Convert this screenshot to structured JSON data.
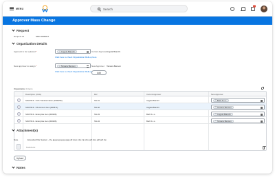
{
  "nav": {
    "menu_label": "MENU",
    "search_placeholder": "Search",
    "inbox_badge": "1"
  },
  "page": {
    "title": "Approver Mass Change"
  },
  "request": {
    "section_title": "Request",
    "request_id_label": "Request ID",
    "request_id_value": "MSC-0000017"
  },
  "org": {
    "section_title": "Organization Details",
    "approval_label": "Approval to be replaced",
    "approval_value": "Angela Bianchi",
    "new_approver_label": "New approver to assign",
    "new_approver_value": "Tamara Benson",
    "check_link": "Click here to check Organization Roll-up here",
    "check_link_2": "Click here to check Organization Roll-up here",
    "current_approver_label": "Current Approver",
    "current_approver_value": "Angela Bianchi",
    "new_approver_right_label": "New Approver",
    "new_approver_right_value": "Tamara Benson",
    "add_label": "Add"
  },
  "grid": {
    "caption": "Organization",
    "count": "4 items",
    "headers": [
      "Description (Units)",
      "Ref",
      "Current Approver",
      "New Approver"
    ],
    "rows": [
      {
        "desc": "SNU7613 - CCS Transformation (F000252)",
        "ref": "SN-01",
        "current": "Angela Bianchi",
        "new": "Beth S.r.o."
      },
      {
        "desc": "SNU7613 - US Account Gen (000571)",
        "ref": "SN-02",
        "current": "Angela Bianchi",
        "new": "Tamara Benson"
      },
      {
        "desc": "SNU7613 - Enterprise Gen (000266)",
        "ref": "SN-03",
        "current": "Beth S.r.o.",
        "new": "Angela Bianchi"
      },
      {
        "desc": "SNU7613 - Enterprise Gen (000266)",
        "ref": "SN-04",
        "current": "Beth S.r.o.",
        "new": "Tamara Benson"
      }
    ]
  },
  "attachments": {
    "section_title": "Attachment(s)",
    "label": "Note",
    "filename": "Extended File System - the jpg jpg jpg jpg jpg.pdf.docx.xlsx.zip.xlsx.pdf.xlsx.pdf.pdf.zip",
    "size": "Text14.vcs",
    "upload_label": "Upload"
  },
  "notes": {
    "section_title": "Notes"
  },
  "colors": {
    "brand": "#0875e1",
    "badge": "#de4b39"
  }
}
